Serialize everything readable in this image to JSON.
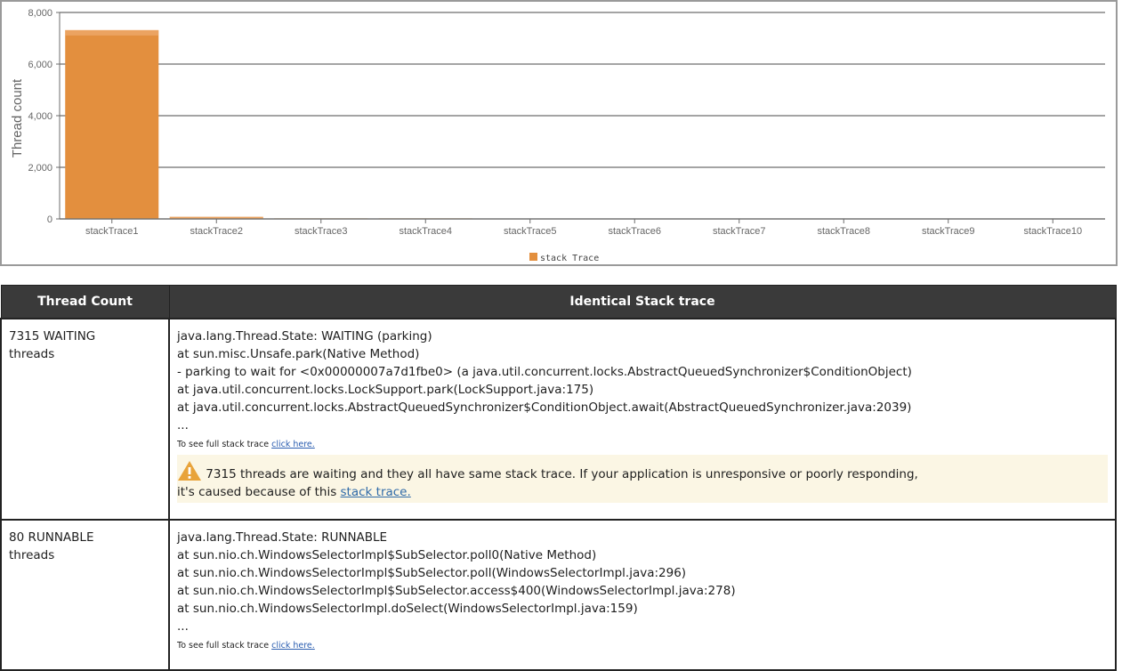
{
  "chart_data": {
    "type": "bar",
    "categories": [
      "stackTrace1",
      "stackTrace2",
      "stackTrace3",
      "stackTrace4",
      "stackTrace5",
      "stackTrace6",
      "stackTrace7",
      "stackTrace8",
      "stackTrace9",
      "stackTrace10"
    ],
    "series": [
      {
        "name": "stack Trace",
        "values": [
          7315,
          80,
          20,
          20,
          0,
          0,
          0,
          0,
          0,
          0
        ]
      }
    ],
    "ylabel": "Thread count",
    "xlabel": "",
    "ylim": [
      0,
      8000
    ],
    "yticks": [
      "0",
      "2,000",
      "4,000",
      "6,000",
      "8,000"
    ],
    "ytick_values": [
      0,
      2000,
      4000,
      6000,
      8000
    ],
    "bar_color": "#e38f3e",
    "grid": true,
    "legend_position": "bottom-center"
  },
  "table": {
    "headers": {
      "count": "Thread Count",
      "trace": "Identical Stack trace"
    },
    "rows": [
      {
        "count_line1": "7315 WAITING",
        "count_line2": "threads",
        "lines": [
          "java.lang.Thread.State: WAITING (parking)",
          "at sun.misc.Unsafe.park(Native Method)",
          "- parking to wait for <0x00000007a7d1fbe0> (a java.util.concurrent.locks.AbstractQueuedSynchronizer$ConditionObject)",
          "at java.util.concurrent.locks.LockSupport.park(LockSupport.java:175)",
          "at java.util.concurrent.locks.AbstractQueuedSynchronizer$ConditionObject.await(AbstractQueuedSynchronizer.java:2039)",
          "..."
        ],
        "note_prefix": "To see full stack trace ",
        "note_link": "click here.",
        "warning_text1": "7315 threads are waiting and they all have same stack trace. If your application is unresponsive or poorly responding,",
        "warning_text2": "it's caused because of this ",
        "warning_link": "stack trace."
      },
      {
        "count_line1": "80 RUNNABLE",
        "count_line2": "threads",
        "lines": [
          "java.lang.Thread.State: RUNNABLE",
          "at sun.nio.ch.WindowsSelectorImpl$SubSelector.poll0(Native Method)",
          "at sun.nio.ch.WindowsSelectorImpl$SubSelector.poll(WindowsSelectorImpl.java:296)",
          "at sun.nio.ch.WindowsSelectorImpl$SubSelector.access$400(WindowsSelectorImpl.java:278)",
          "at sun.nio.ch.WindowsSelectorImpl.doSelect(WindowsSelectorImpl.java:159)",
          "..."
        ],
        "note_prefix": "To see full stack trace ",
        "note_link": "click here."
      }
    ]
  }
}
